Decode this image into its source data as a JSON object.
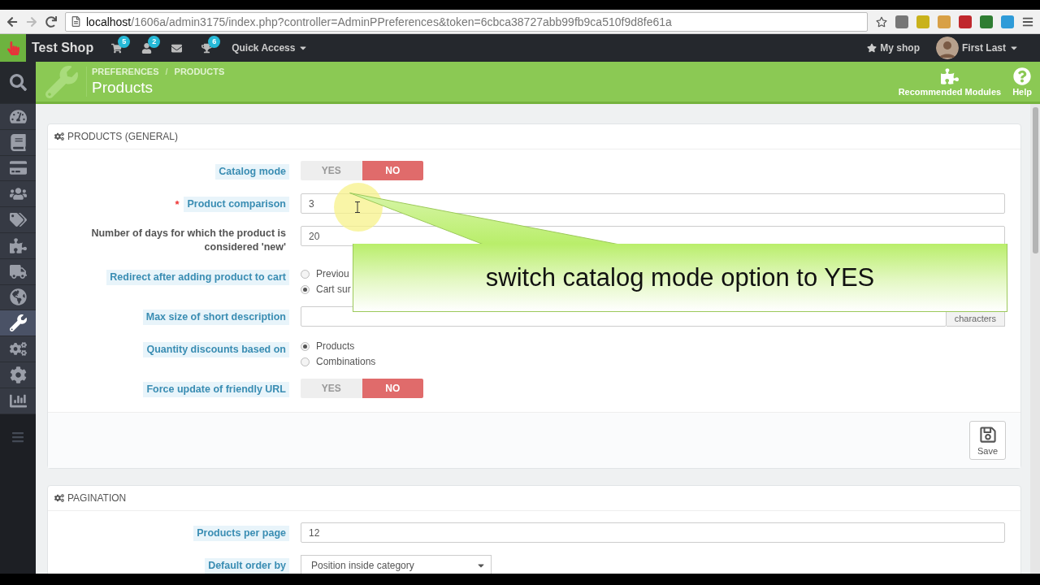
{
  "browser": {
    "url_host": "localhost",
    "url_path": "/1606a/admin3175/index.php?controller=AdminPPreferences&token=6cbca38727abb99fb9ca510f9d8fe61a"
  },
  "header": {
    "shop_name": "Test Shop",
    "notifications": [
      {
        "kind": "cart",
        "count": "5"
      },
      {
        "kind": "person",
        "count": "2"
      },
      {
        "kind": "mail"
      },
      {
        "kind": "trophy",
        "count": "6"
      }
    ],
    "quick_access": "Quick Access",
    "my_shop": "My shop",
    "user": "First Last"
  },
  "toolbar": {
    "breadcrumb": [
      "PREFERENCES",
      "PRODUCTS"
    ],
    "separator": "/",
    "title": "Products",
    "actions": [
      {
        "kind": "puzzle",
        "label": "Recommended Modules"
      },
      {
        "kind": "help",
        "label": "Help"
      }
    ]
  },
  "sidebar": {
    "items": [
      {
        "kind": "search",
        "selected": false
      },
      {
        "kind": "dashboard",
        "selected": false
      },
      {
        "kind": "catalog",
        "selected": false
      },
      {
        "kind": "card",
        "selected": false
      },
      {
        "kind": "customers",
        "selected": false
      },
      {
        "kind": "tags",
        "selected": false
      },
      {
        "kind": "puzzle",
        "selected": false
      },
      {
        "kind": "truck",
        "selected": false
      },
      {
        "kind": "globe",
        "selected": false
      },
      {
        "kind": "wrench",
        "selected": true
      },
      {
        "kind": "gears",
        "selected": false
      },
      {
        "kind": "gear",
        "selected": false
      },
      {
        "kind": "stats",
        "selected": false
      }
    ]
  },
  "panels": [
    {
      "title": "PRODUCTS (GENERAL)",
      "save": "Save",
      "fields": [
        {
          "kind": "switch",
          "label": "Catalog mode",
          "help": true,
          "options": [
            "YES",
            "NO"
          ],
          "on": false
        },
        {
          "kind": "text",
          "label": "Product comparison",
          "help": true,
          "required_mark": "*",
          "value": "3"
        },
        {
          "kind": "text",
          "label": "Number of days for which the product is considered 'new'",
          "help": false,
          "value": "20"
        },
        {
          "kind": "radio",
          "label": "Redirect after adding product to cart",
          "help": true,
          "options": [
            {
              "label": "Previou",
              "selected": false
            },
            {
              "label": "Cart sur",
              "selected": true
            }
          ]
        },
        {
          "kind": "text",
          "label": "Max size of short description",
          "help": true,
          "addon": "characters"
        },
        {
          "kind": "radio",
          "label": "Quantity discounts based on",
          "help": true,
          "options": [
            {
              "label": "Products",
              "selected": true
            },
            {
              "label": "Combinations",
              "selected": false
            }
          ]
        },
        {
          "kind": "switch",
          "label": "Force update of friendly URL",
          "help": true,
          "options": [
            "YES",
            "NO"
          ],
          "on": false
        }
      ]
    },
    {
      "title": "PAGINATION",
      "fields": [
        {
          "kind": "text",
          "label": "Products per page",
          "help": true,
          "value": "12"
        },
        {
          "kind": "select",
          "label": "Default order by",
          "help": true,
          "value": "Position inside category"
        }
      ]
    }
  ],
  "annotation": {
    "text": "switch catalog mode option to YES"
  }
}
